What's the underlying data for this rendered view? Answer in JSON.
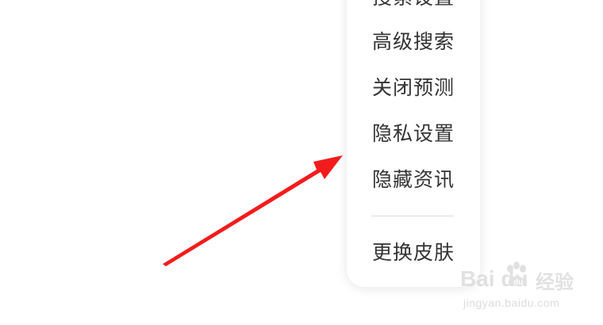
{
  "menu": {
    "items": [
      {
        "label": "搜索设置"
      },
      {
        "label": "高级搜索"
      },
      {
        "label": "关闭预测"
      },
      {
        "label": "隐私设置"
      },
      {
        "label": "隐藏资讯"
      },
      {
        "label": "更换皮肤"
      }
    ]
  },
  "annotation": {
    "arrow_color": "#f21c1c"
  },
  "watermark": {
    "logo": "Bai du",
    "cn": "经验",
    "url": "jingyan.baidu.com"
  },
  "colors": {
    "menu_text": "#333333",
    "divider": "#dcdcdc",
    "background": "#ffffff"
  }
}
